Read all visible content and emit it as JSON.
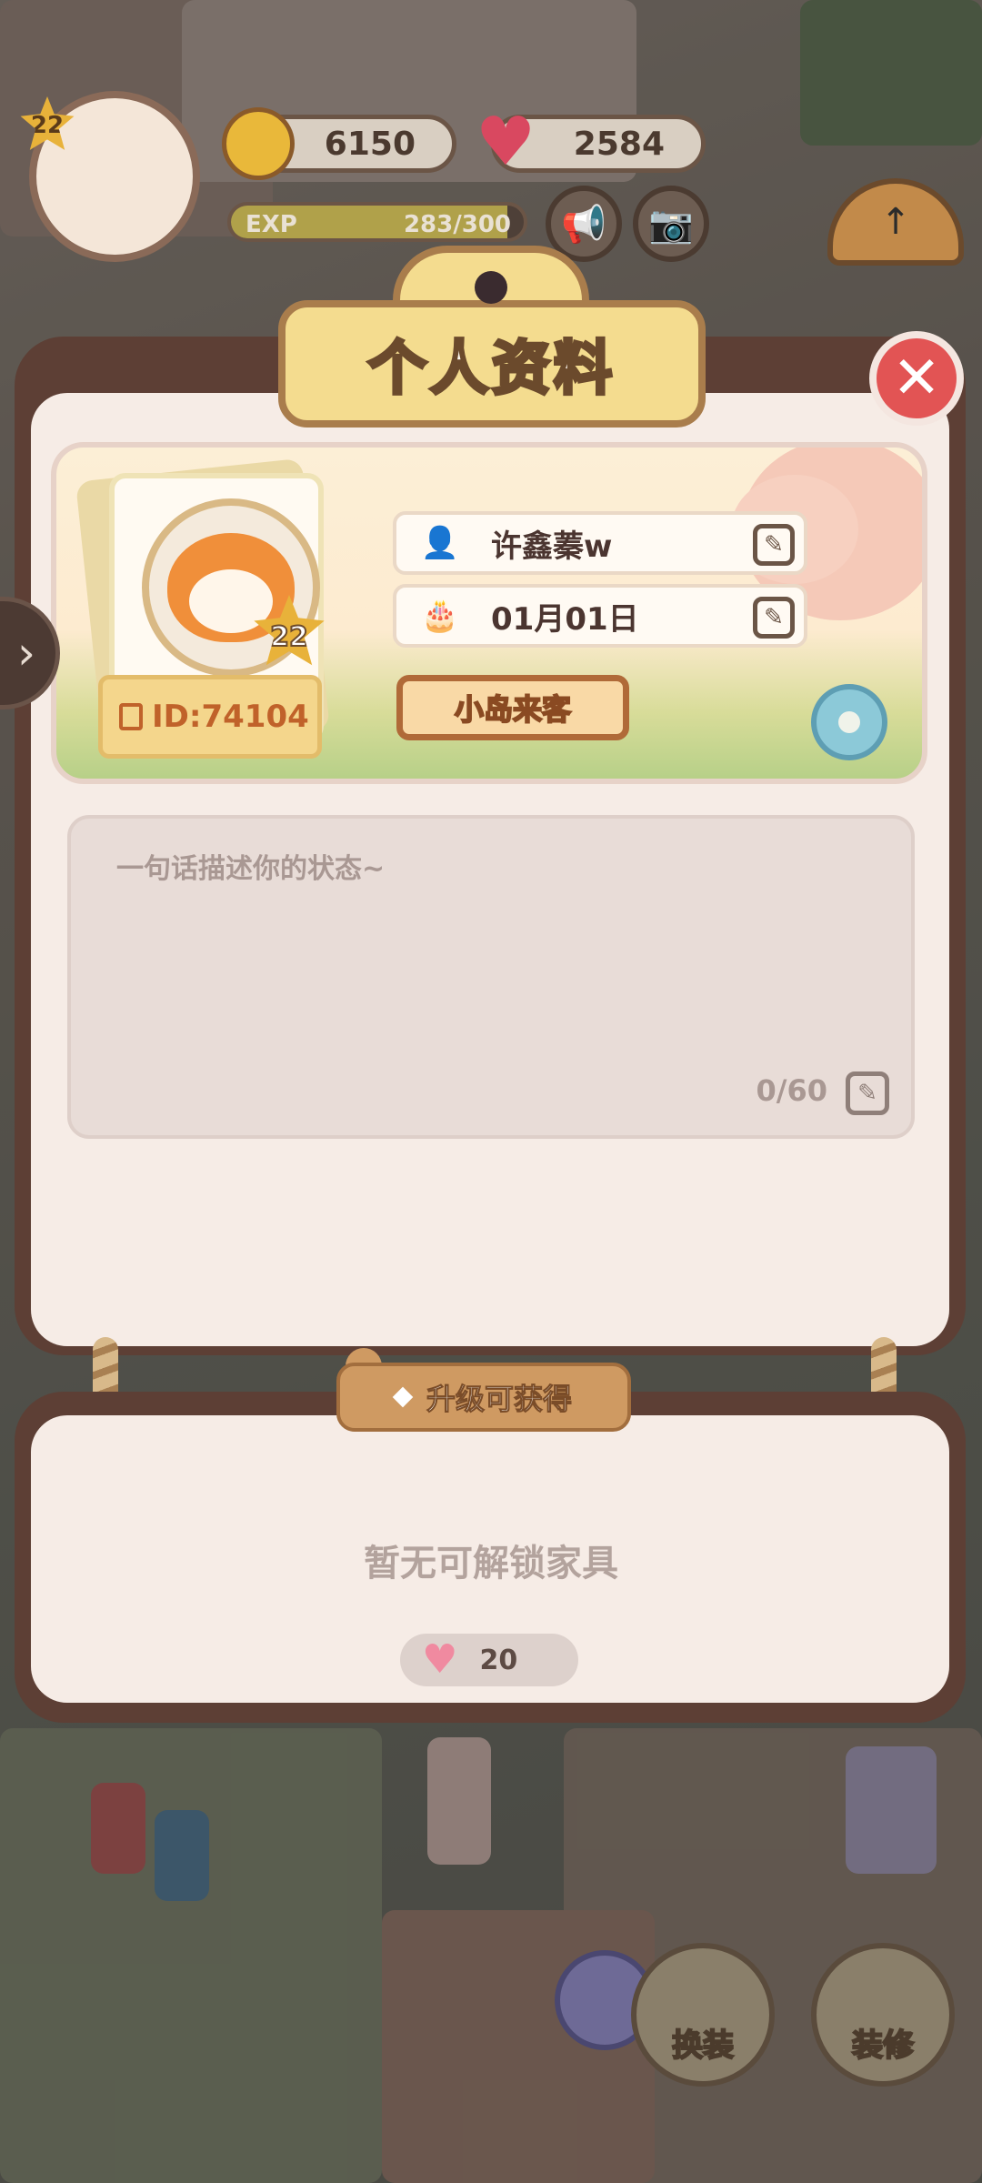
{
  "hud": {
    "level": "22",
    "coins": "6150",
    "hearts": "2584",
    "exp_label": "EXP",
    "exp_value": "283/300",
    "exp_fraction": 0.943,
    "icons": [
      "coin-icon",
      "heart-icon",
      "megaphone-icon",
      "camera-icon",
      "compass-arrow-icon"
    ]
  },
  "panel": {
    "title": "个人资料",
    "close_icon": "close-icon"
  },
  "profile": {
    "avatar_level": "22",
    "id_text": "ID:74104",
    "name": "许鑫蓁w",
    "birthday": "01月01日",
    "title_badge": "小岛来客"
  },
  "status": {
    "placeholder": "一句话描述你的状态~",
    "count": "0/60"
  },
  "reward": {
    "tab_label": "升级可获得",
    "empty_text": "暂无可解锁家具",
    "heart_count": "20"
  },
  "bottom": {
    "dress_up": "换装",
    "decorate": "装修"
  },
  "colors": {
    "panel_frame": "#5d3f35",
    "panel_inner": "#f6ece6",
    "title_plate": "#f4dc8f",
    "close_red": "#e25454"
  }
}
